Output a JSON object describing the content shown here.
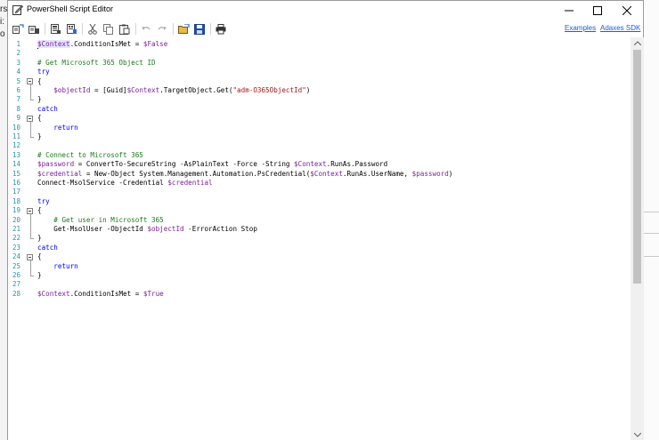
{
  "background": {
    "left_labels": [
      "rs",
      "i:",
      "o"
    ]
  },
  "window": {
    "title": "PowerShell Script Editor"
  },
  "toolbar": {
    "links": [
      "Examples",
      "Adaxes SDK"
    ]
  },
  "editor": {
    "line_numbers": [
      "1",
      "2",
      "3",
      "4",
      "5",
      "6",
      "7",
      "8",
      "9",
      "10",
      "11",
      "12",
      "13",
      "14",
      "15",
      "16",
      "17",
      "18",
      "19",
      "20",
      "21",
      "22",
      "23",
      "24",
      "25",
      "26",
      "27",
      "28"
    ],
    "lines": [
      [
        {
          "t": "var",
          "v": "$Context"
        },
        {
          "t": "txt",
          "v": ".ConditionIsMet = "
        },
        {
          "t": "var",
          "v": "$False"
        }
      ],
      [],
      [
        {
          "t": "cm",
          "v": "# Get Microsoft 365 Object ID"
        }
      ],
      [
        {
          "t": "kw",
          "v": "try"
        }
      ],
      [
        {
          "t": "txt",
          "v": "{"
        }
      ],
      [
        {
          "t": "txt",
          "v": "    "
        },
        {
          "t": "var",
          "v": "$objectId"
        },
        {
          "t": "txt",
          "v": " = [Guid]"
        },
        {
          "t": "var",
          "v": "$Context"
        },
        {
          "t": "txt",
          "v": ".TargetObject.Get("
        },
        {
          "t": "str",
          "v": "\"adm-O365ObjectId\""
        },
        {
          "t": "txt",
          "v": ")"
        }
      ],
      [
        {
          "t": "txt",
          "v": "}"
        }
      ],
      [
        {
          "t": "kw",
          "v": "catch"
        }
      ],
      [
        {
          "t": "txt",
          "v": "{"
        }
      ],
      [
        {
          "t": "txt",
          "v": "    "
        },
        {
          "t": "kw",
          "v": "return"
        }
      ],
      [
        {
          "t": "txt",
          "v": "}"
        }
      ],
      [],
      [
        {
          "t": "cm",
          "v": "# Connect to Microsoft 365"
        }
      ],
      [
        {
          "t": "var",
          "v": "$password"
        },
        {
          "t": "txt",
          "v": " = ConvertTo-SecureString -AsPlainText -Force -String "
        },
        {
          "t": "var",
          "v": "$Context"
        },
        {
          "t": "txt",
          "v": ".RunAs.Password"
        }
      ],
      [
        {
          "t": "var",
          "v": "$credential"
        },
        {
          "t": "txt",
          "v": " = New-Object System.Management.Automation.PsCredential("
        },
        {
          "t": "var",
          "v": "$Context"
        },
        {
          "t": "txt",
          "v": ".RunAs.UserName, "
        },
        {
          "t": "var",
          "v": "$password"
        },
        {
          "t": "txt",
          "v": ")"
        }
      ],
      [
        {
          "t": "txt",
          "v": "Connect-MsolService -Credential "
        },
        {
          "t": "var",
          "v": "$credential"
        }
      ],
      [],
      [
        {
          "t": "kw",
          "v": "try"
        }
      ],
      [
        {
          "t": "txt",
          "v": "{"
        }
      ],
      [
        {
          "t": "txt",
          "v": "    "
        },
        {
          "t": "cm",
          "v": "# Get user in Microsoft 365"
        }
      ],
      [
        {
          "t": "txt",
          "v": "    Get-MsolUser -ObjectId "
        },
        {
          "t": "var",
          "v": "$objectId"
        },
        {
          "t": "txt",
          "v": " -ErrorAction Stop"
        }
      ],
      [
        {
          "t": "txt",
          "v": "}"
        }
      ],
      [
        {
          "t": "kw",
          "v": "catch"
        }
      ],
      [
        {
          "t": "txt",
          "v": "{"
        }
      ],
      [
        {
          "t": "txt",
          "v": "    "
        },
        {
          "t": "kw",
          "v": "return"
        }
      ],
      [
        {
          "t": "txt",
          "v": "}"
        }
      ],
      [],
      [
        {
          "t": "var",
          "v": "$Context"
        },
        {
          "t": "txt",
          "v": ".ConditionIsMet = "
        },
        {
          "t": "var",
          "v": "$True"
        }
      ]
    ]
  }
}
